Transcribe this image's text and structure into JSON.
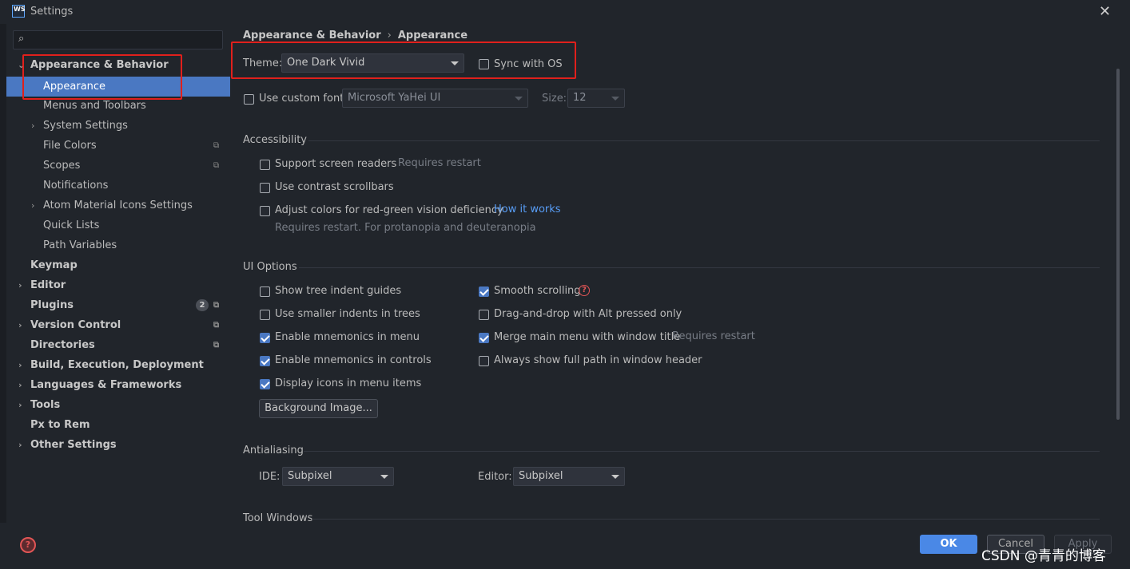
{
  "window": {
    "title": "Settings",
    "logo": "WS",
    "close_glyph": "✕"
  },
  "sidebar": {
    "search_placeholder": "",
    "items": [
      {
        "label": "Appearance & Behavior",
        "expanded": true
      },
      {
        "label": "Appearance",
        "selected": true
      },
      {
        "label": "Menus and Toolbars"
      },
      {
        "label": "System Settings"
      },
      {
        "label": "File Colors"
      },
      {
        "label": "Scopes"
      },
      {
        "label": "Notifications"
      },
      {
        "label": "Atom Material Icons Settings"
      },
      {
        "label": "Quick Lists"
      },
      {
        "label": "Path Variables"
      },
      {
        "label": "Keymap"
      },
      {
        "label": "Editor"
      },
      {
        "label": "Plugins",
        "badge": "2"
      },
      {
        "label": "Version Control"
      },
      {
        "label": "Directories"
      },
      {
        "label": "Build, Execution, Deployment"
      },
      {
        "label": "Languages & Frameworks"
      },
      {
        "label": "Tools"
      },
      {
        "label": "Px to Rem"
      },
      {
        "label": "Other Settings"
      }
    ]
  },
  "breadcrumb": {
    "parent": "Appearance & Behavior",
    "current": "Appearance",
    "separator": "›"
  },
  "theme": {
    "label": "Theme:",
    "value": "One Dark Vivid",
    "sync_label": "Sync with OS",
    "sync_checked": false
  },
  "font": {
    "use_custom_label": "Use custom font:",
    "font_value": "Microsoft YaHei UI",
    "size_label": "Size:",
    "size_value": "12"
  },
  "accessibility": {
    "title": "Accessibility",
    "screen_readers": "Support screen readers",
    "screen_readers_note": "Requires restart",
    "contrast_scrollbars": "Use contrast scrollbars",
    "adjust_colors": "Adjust colors for red-green vision deficiency",
    "how_it_works": "How it works",
    "adjust_note": "Requires restart. For protanopia and deuteranopia"
  },
  "ui_options": {
    "title": "UI Options",
    "left": [
      {
        "label": "Show tree indent guides",
        "checked": false
      },
      {
        "label": "Use smaller indents in trees",
        "checked": false
      },
      {
        "label": "Enable mnemonics in menu",
        "checked": true
      },
      {
        "label": "Enable mnemonics in controls",
        "checked": true
      },
      {
        "label": "Display icons in menu items",
        "checked": true
      }
    ],
    "right": [
      {
        "label": "Smooth scrolling",
        "checked": true
      },
      {
        "label": "Drag-and-drop with Alt pressed only",
        "checked": false
      },
      {
        "label": "Merge main menu with window title",
        "checked": true
      },
      {
        "label": "Always show full path in window header",
        "checked": false
      }
    ],
    "merge_note": "Requires restart",
    "background_button": "Background Image..."
  },
  "antialiasing": {
    "title": "Antialiasing",
    "ide_label": "IDE:",
    "ide_value": "Subpixel",
    "editor_label": "Editor:",
    "editor_value": "Subpixel"
  },
  "tool_windows": {
    "title": "Tool Windows"
  },
  "footer": {
    "ok": "OK",
    "cancel": "Cancel",
    "apply": "Apply",
    "watermark": "CSDN @青青的博客"
  },
  "colors": {
    "accent": "#4a78c2",
    "highlight_box": "#e0201c",
    "ok_button": "#4a88e6",
    "background": "#21252b"
  }
}
